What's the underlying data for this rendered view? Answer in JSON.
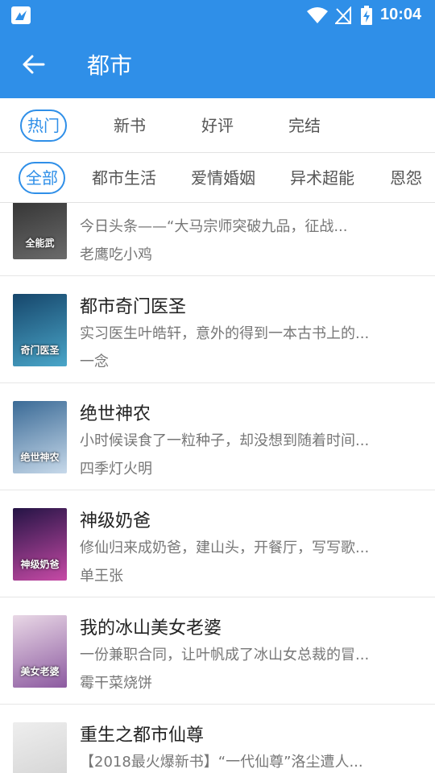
{
  "status_bar": {
    "time": "10:04"
  },
  "app_bar": {
    "title": "都市"
  },
  "filter_tabs": [
    {
      "label": "热门",
      "active": true
    },
    {
      "label": "新书",
      "active": false
    },
    {
      "label": "好评",
      "active": false
    },
    {
      "label": "完结",
      "active": false
    }
  ],
  "category_tabs": [
    {
      "label": "全部",
      "active": true
    },
    {
      "label": "都市生活",
      "active": false
    },
    {
      "label": "爱情婚姻",
      "active": false
    },
    {
      "label": "异术超能",
      "active": false
    },
    {
      "label": "恩怨",
      "active": false
    }
  ],
  "books": [
    {
      "title": "",
      "desc": "今日头条——“大马宗师突破九品，征战...",
      "author": "老鹰吃小鸡",
      "cover_text": "全能武",
      "cover_colors": [
        "#2b2b2b",
        "#6b6b6b"
      ]
    },
    {
      "title": "都市奇门医圣",
      "desc": "实习医生叶皓轩，意外的得到一本古书上的...",
      "author": "一念",
      "cover_text": "奇门医圣",
      "cover_colors": [
        "#16466b",
        "#4aa6c9"
      ]
    },
    {
      "title": "绝世神农",
      "desc": "小时候误食了一粒种子，却没想到随着时间...",
      "author": "四季灯火明",
      "cover_text": "绝世神农",
      "cover_colors": [
        "#3a6a96",
        "#c7d9ea"
      ]
    },
    {
      "title": "神级奶爸",
      "desc": "修仙归来成奶爸，建山头，开餐厅，写写歌...",
      "author": "单王张",
      "cover_text": "神级奶爸",
      "cover_colors": [
        "#241445",
        "#c74aa6"
      ]
    },
    {
      "title": "我的冰山美女老婆",
      "desc": "一份兼职合同，让叶帆成了冰山女总裁的冒...",
      "author": "霉干菜烧饼",
      "cover_text": "美女老婆",
      "cover_colors": [
        "#e9d8e6",
        "#8c5aa0"
      ]
    },
    {
      "title": "重生之都市仙尊",
      "desc": "【2018最火爆新书】“一代仙尊”洛尘遭人...",
      "author": "",
      "cover_text": "",
      "cover_colors": [
        "#eeeeee",
        "#cfcfcf"
      ]
    }
  ]
}
